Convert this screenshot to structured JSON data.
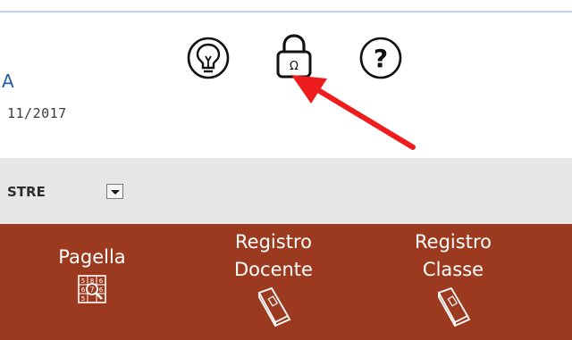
{
  "header": {
    "title_fragment": "A",
    "date_fragment": "11/2017",
    "toolbar": [
      {
        "name": "lightbulb-icon",
        "label": "Suggerimenti"
      },
      {
        "name": "lock-icon",
        "label": "Password"
      },
      {
        "name": "help-icon",
        "label": "Aiuto"
      }
    ]
  },
  "annotation": {
    "arrow_color": "#ee1c1c",
    "points_to": "lock-icon"
  },
  "filter": {
    "label": "STRE"
  },
  "nav": {
    "items": [
      {
        "label": "Pagella",
        "icon": "report-card-icon"
      },
      {
        "label": "Registro\nDocente",
        "icon": "book-icon"
      },
      {
        "label": "Registro\nClasse",
        "icon": "book-icon"
      }
    ]
  },
  "colors": {
    "nav_bg": "#9c3a1f",
    "filter_bg": "#e7e7e7",
    "top_border": "#c6d3e6"
  }
}
